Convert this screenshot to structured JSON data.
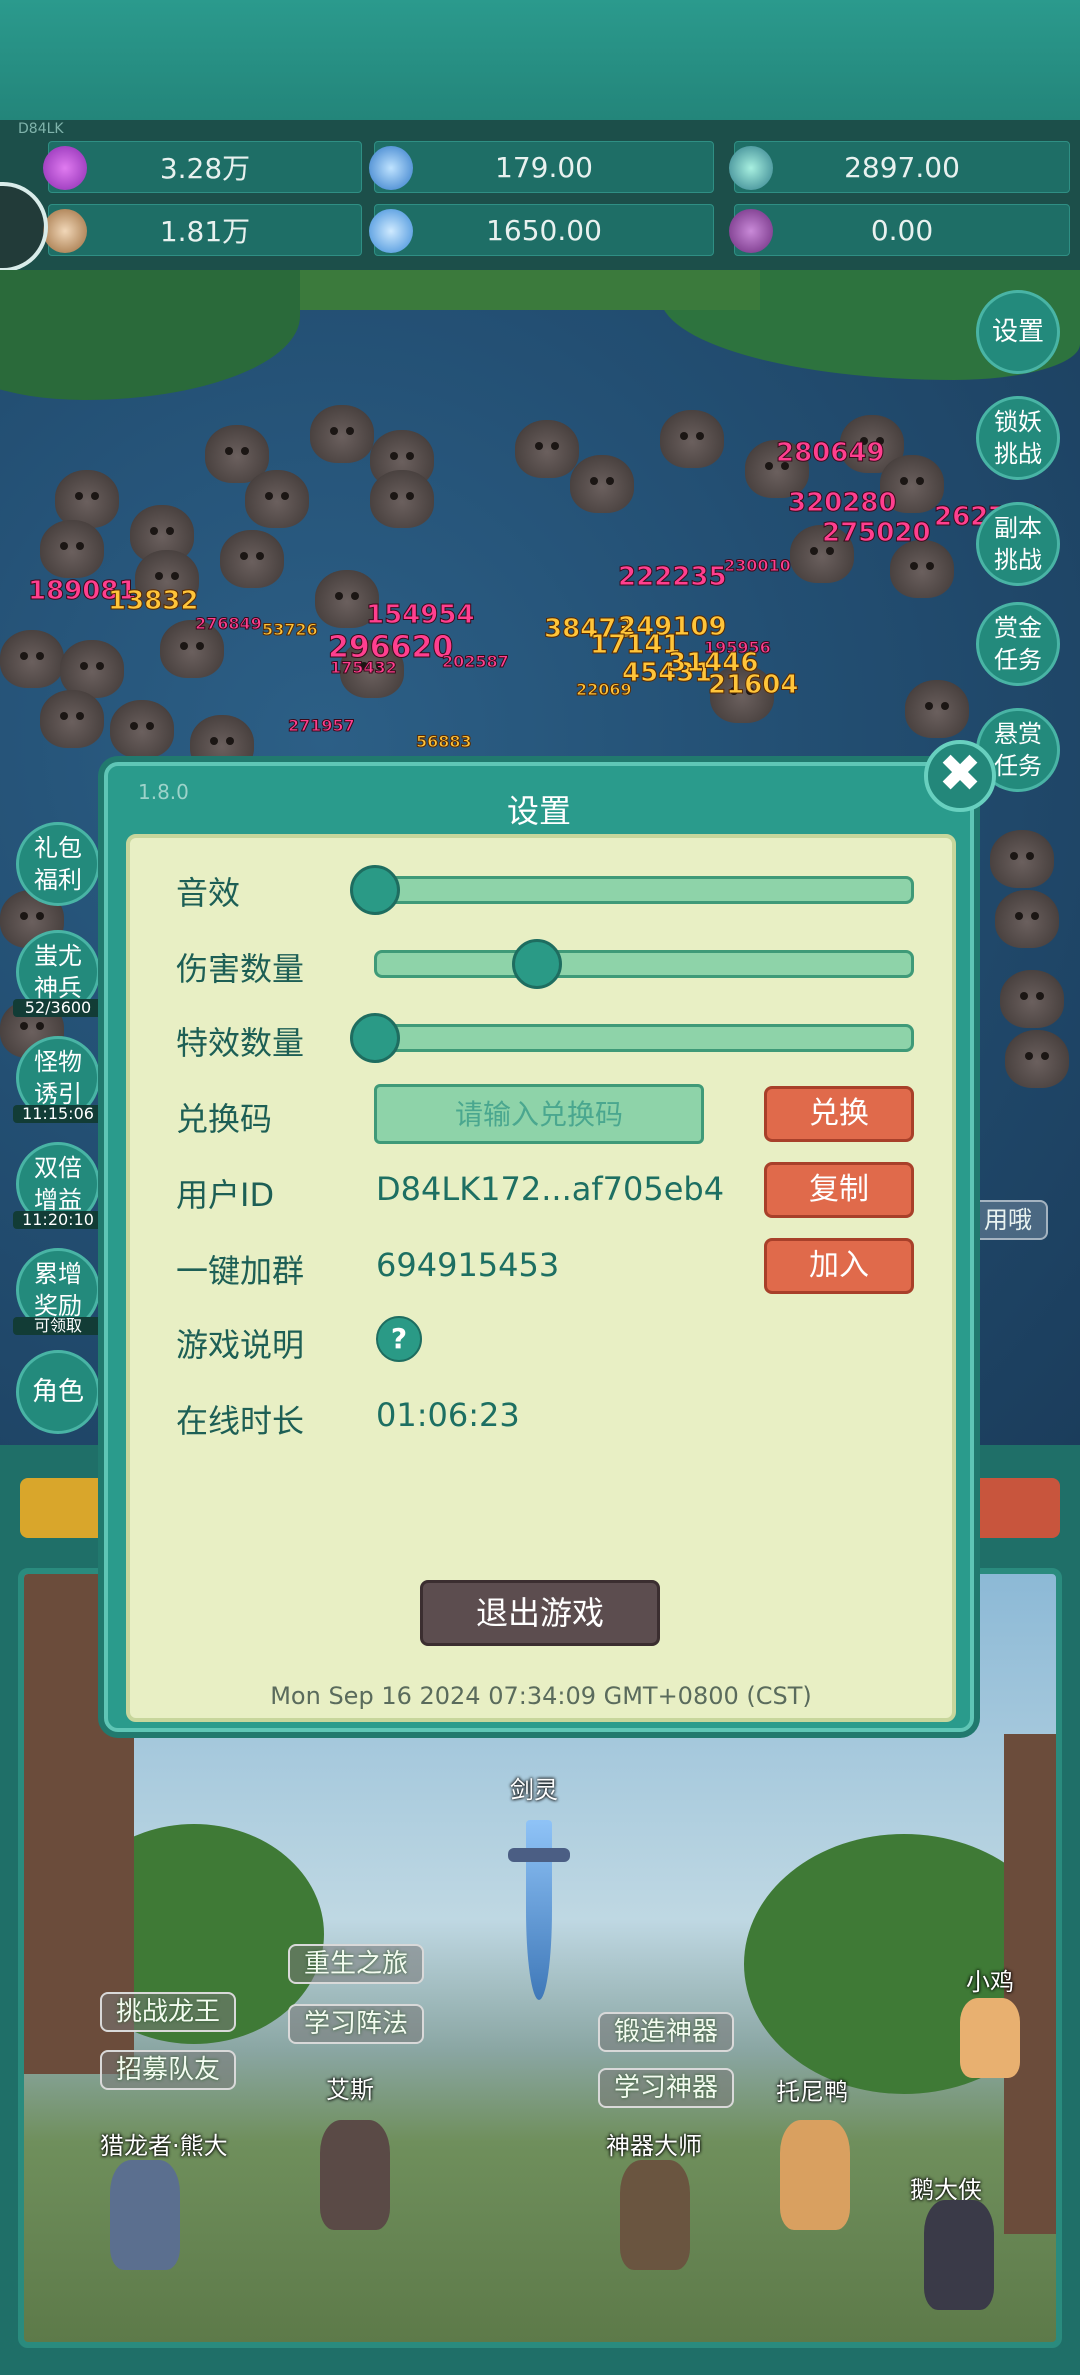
{
  "resources": {
    "player_tag": "D84LK",
    "items": [
      {
        "icon": "purple-gem-icon",
        "value": "3.28万"
      },
      {
        "icon": "blue-orb-icon",
        "value": "179.00"
      },
      {
        "icon": "green-orb-icon",
        "value": "2897.00"
      },
      {
        "icon": "horn-icon",
        "value": "1.81万"
      },
      {
        "icon": "blue-crystal-icon",
        "value": "1650.00"
      },
      {
        "icon": "purple-bag-icon",
        "value": "0.00"
      }
    ]
  },
  "right_menu": [
    {
      "label": "设置"
    },
    {
      "label": "锁妖挑战"
    },
    {
      "label": "副本挑战"
    },
    {
      "label": "赏金任务"
    },
    {
      "label": "悬赏任务"
    }
  ],
  "left_menu": [
    {
      "label": "礼包福利",
      "sub": ""
    },
    {
      "label": "蚩尤神兵",
      "sub": "52/3600"
    },
    {
      "label": "怪物诱引",
      "sub": "11:15:06"
    },
    {
      "label": "双倍增益",
      "sub": "11:20:10"
    },
    {
      "label": "累增奖励",
      "sub": "可领取"
    },
    {
      "label": "角色",
      "sub": ""
    }
  ],
  "battle": {
    "used_tag": "用哦",
    "damage_numbers": [
      "280649",
      "320280",
      "275020",
      "262710",
      "222235",
      "230010",
      "189081",
      "13832",
      "276849",
      "53726",
      "154954",
      "296620",
      "202587",
      "38473",
      "249109",
      "17141",
      "195956",
      "45431",
      "31446",
      "21604",
      "271957",
      "22069",
      "56883",
      "175432"
    ]
  },
  "settings": {
    "version": "1.8.0",
    "title": "设置",
    "sound_label": "音效",
    "sound_level": 0,
    "damage_count_label": "伤害数量",
    "damage_count_level": 0.3,
    "effects_count_label": "特效数量",
    "effects_count_level": 0,
    "redeem_label": "兑换码",
    "redeem_placeholder": "请输入兑换码",
    "redeem_button": "兑换",
    "user_id_label": "用户ID",
    "user_id_value": "D84LK172...af705eb4",
    "copy_button": "复制",
    "group_label": "一键加群",
    "group_value": "694915453",
    "join_button": "加入",
    "guide_label": "游戏说明",
    "guide_icon": "?",
    "online_label": "在线时长",
    "online_value": "01:06:23",
    "exit_button": "退出游戏",
    "timestamp": "Mon Sep 16 2024 07:34:09 GMT+0800 (CST)",
    "close_icon": "✖"
  },
  "village": {
    "sword_label": "剑灵",
    "buttons": {
      "rebirth": "重生之旅",
      "learn_formation": "学习阵法",
      "challenge_dragon": "挑战龙王",
      "recruit": "招募队友",
      "forge": "锻造神器",
      "learn_artifact": "学习神器"
    },
    "npcs": {
      "aisi": "艾斯",
      "dragon_hunter": "猎龙者·熊大",
      "master": "神器大师",
      "tony_duck": "托尼鸭",
      "chick": "小鸡",
      "goose": "鹅大侠"
    }
  }
}
